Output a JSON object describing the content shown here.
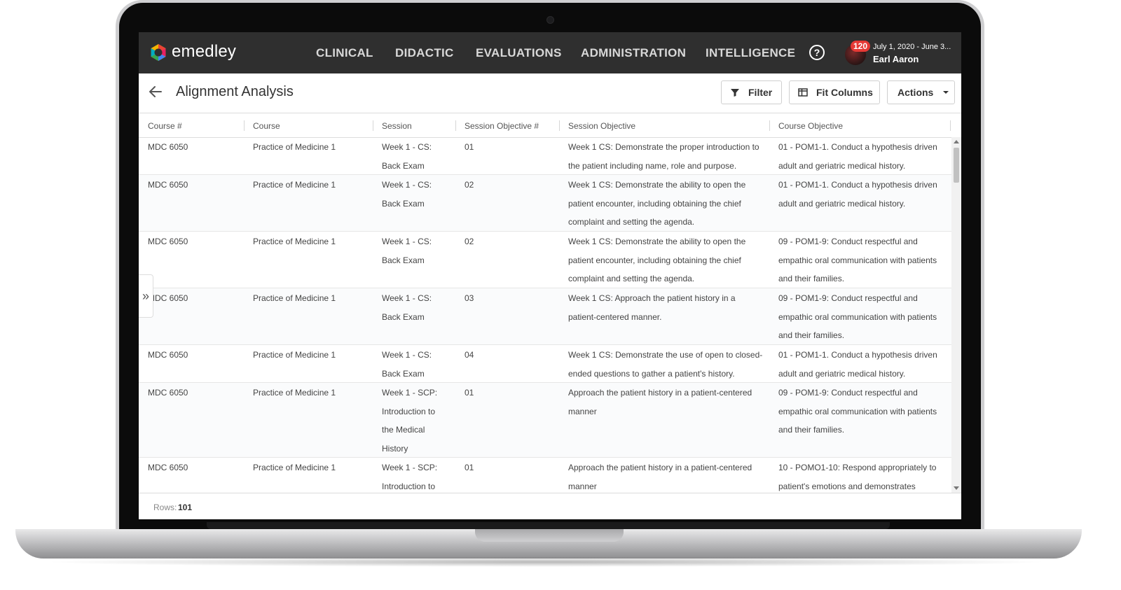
{
  "brand": {
    "name": "emedley"
  },
  "nav": {
    "items": [
      {
        "label": "CLINICAL"
      },
      {
        "label": "DIDACTIC"
      },
      {
        "label": "EVALUATIONS"
      },
      {
        "label": "ADMINISTRATION"
      },
      {
        "label": "INTELLIGENCE"
      }
    ],
    "help_symbol": "?"
  },
  "user": {
    "notification_count": "120",
    "period": "July 1, 2020 - June 3...",
    "name": "Earl Aaron"
  },
  "header": {
    "title": "Alignment Analysis",
    "filter_label": "Filter",
    "fit_columns_label": "Fit Columns",
    "actions_label": "Actions"
  },
  "grid": {
    "columns": [
      "Course #",
      "Course",
      "Session",
      "Session Objective #",
      "Session Objective",
      "Course Objective"
    ],
    "rows": [
      {
        "course_num": "MDC 6050",
        "course": "Practice of Medicine 1",
        "session": [
          "Week 1 - CS:",
          "Back Exam"
        ],
        "obj_num": "01",
        "session_objective": [
          "Week 1 CS: Demonstrate the proper introduction to",
          "the patient including name, role and purpose."
        ],
        "course_objective": [
          "01 - POM1-1. Conduct a hypothesis driven",
          "adult and geriatric medical history."
        ]
      },
      {
        "course_num": "MDC 6050",
        "course": "Practice of Medicine 1",
        "session": [
          "Week 1 - CS:",
          "Back Exam"
        ],
        "obj_num": "02",
        "session_objective": [
          "Week 1 CS: Demonstrate the ability to open the",
          "patient encounter, including obtaining the chief",
          "complaint and setting the agenda."
        ],
        "course_objective": [
          "01 - POM1-1. Conduct a hypothesis driven",
          "adult and geriatric medical history."
        ]
      },
      {
        "course_num": "MDC 6050",
        "course": "Practice of Medicine 1",
        "session": [
          "Week 1 - CS:",
          "Back Exam"
        ],
        "obj_num": "02",
        "session_objective": [
          "Week 1 CS: Demonstrate the ability to open the",
          "patient encounter, including obtaining the chief",
          "complaint and setting the agenda."
        ],
        "course_objective": [
          "09 - POM1-9: Conduct respectful and",
          "empathic oral communication with patients",
          "and their families."
        ]
      },
      {
        "course_num": "MDC 6050",
        "course": "Practice of Medicine 1",
        "session": [
          "Week 1 - CS:",
          "Back Exam"
        ],
        "obj_num": "03",
        "session_objective": [
          "Week 1 CS: Approach the patient history in a",
          "patient-centered manner."
        ],
        "course_objective": [
          "09 - POM1-9: Conduct respectful and",
          "empathic oral communication with patients",
          "and their families."
        ]
      },
      {
        "course_num": "MDC 6050",
        "course": "Practice of Medicine 1",
        "session": [
          "Week 1 - CS:",
          "Back Exam"
        ],
        "obj_num": "04",
        "session_objective": [
          "Week 1 CS: Demonstrate the use of open to closed-",
          "ended questions to gather a patient's history."
        ],
        "course_objective": [
          "01 - POM1-1. Conduct a hypothesis driven",
          "adult and geriatric medical history."
        ]
      },
      {
        "course_num": "MDC 6050",
        "course": "Practice of Medicine 1",
        "session": [
          "Week 1 - SCP:",
          "Introduction to",
          "the Medical",
          "History"
        ],
        "obj_num": "01",
        "session_objective": [
          "Approach the patient history in a patient-centered",
          "manner"
        ],
        "course_objective": [
          "09 - POM1-9: Conduct respectful and",
          "empathic oral communication with patients",
          "and their families."
        ]
      },
      {
        "course_num": "MDC 6050",
        "course": "Practice of Medicine 1",
        "session": [
          "Week 1 - SCP:",
          "Introduction to"
        ],
        "obj_num": "01",
        "session_objective": [
          "Approach the patient history in a patient-centered",
          "manner"
        ],
        "course_objective": [
          "10 - POMO1-10: Respond appropriately to",
          "patient's emotions and demonstrates"
        ]
      }
    ]
  },
  "footer": {
    "rows_label": "Rows:",
    "rows_count": "101"
  },
  "side_toggle_symbol": "»",
  "colors": {
    "nav_bg": "#2f2f2f",
    "badge": "#e53935"
  }
}
